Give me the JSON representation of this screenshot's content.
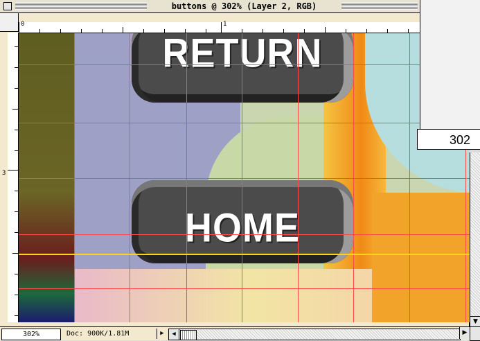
{
  "window": {
    "title": "buttons @ 302%  (Layer 2, RGB)"
  },
  "rulers": {
    "h_labels": [
      "0",
      "1"
    ],
    "v_labels": [
      "3"
    ]
  },
  "canvas": {
    "buttons": [
      {
        "label": "RETURN"
      },
      {
        "label": "HOME"
      }
    ],
    "guide_color": "#ff4a4a",
    "yellow_guide_color": "#ffd21e"
  },
  "statusbar": {
    "zoom": "302%",
    "doc_size": "Doc: 900K/1.81M"
  },
  "palette": {
    "zoom_field": "302"
  },
  "icons": {
    "close": "close-box-icon",
    "arrow": "triangle-right-icon",
    "scroll_left": "arrow-left-icon",
    "scroll_right": "arrow-right-icon",
    "scroll_down": "arrow-down-icon"
  }
}
